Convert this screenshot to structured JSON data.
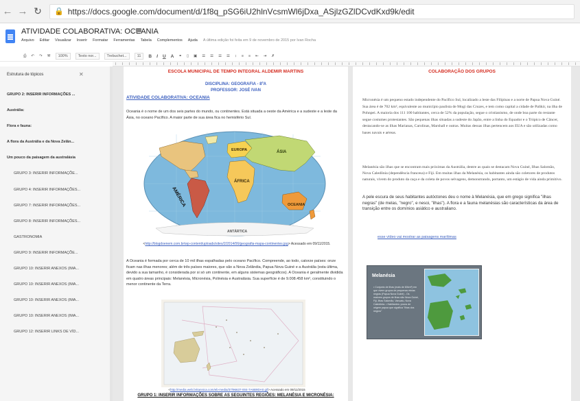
{
  "browser": {
    "url": "https://docs.google.com/document/d/1f8q_pSG6iU2hlnVcsmWl6jDxa_ASjlzGZlDCvdKxd9k/edit"
  },
  "doc": {
    "title": "ATIVIDADE COLABORATIVA: OCEANIA",
    "menus": [
      "Arquivo",
      "Editar",
      "Visualizar",
      "Inserir",
      "Formatar",
      "Ferramentas",
      "Tabela",
      "Complementos",
      "Ajuda"
    ],
    "last_edit": "A última edição foi feita em 9 de novembro de 2015 por Ivan Rocha"
  },
  "toolbar": {
    "zoom": "100%",
    "style": "Texto nor...",
    "font": "Trebuchet...",
    "size": "11"
  },
  "outline": {
    "title": "Estrutura de tópicos",
    "items": [
      {
        "label": "GRUPO 2: INSERIR INFORMAÇÕES ...",
        "level": 1
      },
      {
        "label": "Austrália:",
        "level": 1
      },
      {
        "label": "Flora e fauna:",
        "level": 1
      },
      {
        "label": "A flora da Austrália e da Nova Zelân...",
        "level": 1
      },
      {
        "label": "Um pouco da paisagem da australásia",
        "level": 1
      },
      {
        "label": "GRUPO 3: INSERIR INFORMAÇÕE...",
        "level": 2
      },
      {
        "label": "GRUPO 4: INSERIR INFORMAÇÕES...",
        "level": 2
      },
      {
        "label": "GRUPO 7: INSERIR INFORMAÇÕES...",
        "level": 2
      },
      {
        "label": "GRUPO 8: INSERIR INFORMAÇÕES...",
        "level": 2
      },
      {
        "label": "GASTRONOMIA",
        "level": 2
      },
      {
        "label": "GRUPO 9: INSERIR INFORMAÇÕE...",
        "level": 2
      },
      {
        "label": "GRUPO 10: INSERIR ANEXOS (IMA...",
        "level": 2
      },
      {
        "label": "GRUPO 10: INSERIR ANEXOS (IMA...",
        "level": 2
      },
      {
        "label": "GRUPO 10: INSERIR ANEXOS (IMA...",
        "level": 2
      },
      {
        "label": "GRUPO 10: INSERIR ANEXOS (IMA...",
        "level": 2
      },
      {
        "label": "GRUPO 12: INSERIR LINKS DE VÍD...",
        "level": 2
      }
    ]
  },
  "page1": {
    "school": "ESCOLA MUNICIPAL DE TEMPO INTEGRAL ALDEMIR MARTINS",
    "discipline": "DISCIPLINA: GEOGRAFIA - 8ºA",
    "professor": "PROFESSOR: JOSÉ IVAN",
    "activity": "ATIVIDADE COLABORATIVA: OCEANIA",
    "intro": "Oceania é o nome de um dos seis partes do mundo, ou continentes. Está situada a oeste da América e a sudeste e a leste da Ásia, no oceano Pacífico. A maior parte de sua área fica no hemisfério Sul.",
    "map_labels": {
      "europa": "EUROPA",
      "asia": "ÁSIA",
      "africa": "ÁFRICA",
      "america": "AMÉRICA",
      "oceania": "OCEANIA",
      "antartica": "ANTÁRTICA"
    },
    "map_caption_link": "http://blogdoenem.com.br/wp-content/uploads/sites/2/2014/06/geografia-mapa-continentes.jpg",
    "map_caption_access": "> Acessado em 09/11/2015.",
    "para2": "A Oceania é formada por cerca de 10 mil ilhas espalhadas pelo oceano Pacífico. Compreende, ao todo, catorze países: onze ficam nas ilhas menores; além de três países maiores, que são a Nova Zelândia, Papua Nova Guiné e a Austrália (esta última, devido a sua tamanho, é considerada por si só um continente, em alguns sistemas geográficos). A Oceania é geralmente dividida em quatro áreas principais: Melanésia, Micronésia, Polinésia e Australásia. Sua superfície é de 9.008.458 km², constituindo o menor continente da Terra.",
    "map2_caption_link": "http://media.web.britannica.com/eb-media/37/96637-004-7A6B9DA0.gif",
    "map2_caption_access": "> Acessado em 09/11/2015",
    "grupo1": "GRUPO 1: INSERIR INFORMAÇÕES SOBRE AS SEGUINTES REGIÕES: MELANÉSIA E MICRONÉSIA:"
  },
  "page2": {
    "title": "COLABORAÇÃO DOS GRUPOS",
    "para1": "Micronésia é um pequeno estado independente do Pacífico Sul, localizado a leste das Filipinas e a norte de Papua Nova Guiné. Sua área é de 702 km², equivalente ao município paulista de Mogi das Cruzes, e tem como capital a cidade de Palikir, na ilha de Pohnpei. A maioria dos 111 100 habitantes, cerca de 52% da população, segue o cristianismo, de onde boa parte do restante segue costumes protestantes. São pequenas ilhas situadas a sudeste do Japão, entre a linha do Equador e o Trópico de Câncer, destacando-se as ilhas Marianas, Carolinas, Marshall e outras. Muitas dessas ilhas pertencem aos EUA e são utilizadas como bases navais e aéreas.",
    "para2": "Melanésia são ilhas que se encontram mais próximas da Austrália, dentre as quais se destacam Nova Guiné, Ilhas Salomão, Nova Caledônia (dependência francesa) e Fiji. Em muitas ilhas da Melanésia, os habitantes ainda são coletores de produtos naturais, vivem do produto da caça e da coleta de povos selvagens, demonstrando, portanto, um estágio de vida ainda primitivo.",
    "para2b": "A pele escura de seus habitantes autóctones deu o nome à Melanésia, que em grego significa \"ilhas negras\" (de melas, \"negro\", e nesoi, \"ilhas\"). A flora e a fauna melanésias são características da área de transição entre os domínios asiático e australiano.",
    "video_link": "esse vídeo vai mostrar as paisagens marítimas",
    "card": {
      "title": "Melanésia",
      "body": "• Conjunto de ilhas (mais de 60km²) em que vivem grupos de pequenas etnias negras (Papua Nova Guiné) - Os maiores grupos de ilhas são Nova Guiné, Fiji, Ilhas Salomão, Vanuatu, Nova Caledônia. • Habitantes: povos de origem papua que significa \"ilhas dos negros\""
    }
  }
}
